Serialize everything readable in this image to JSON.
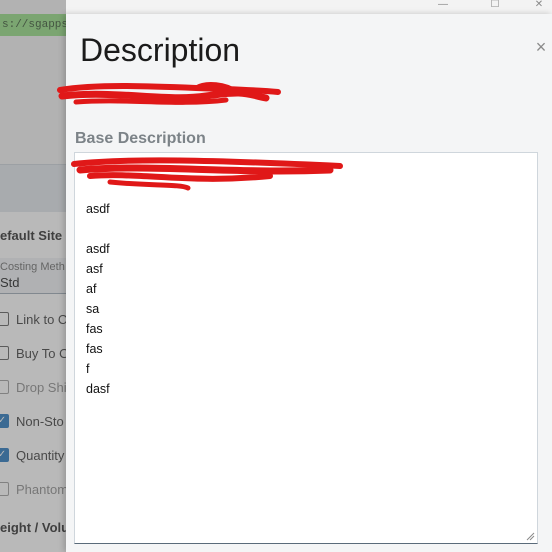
{
  "browser": {
    "url_fragment": "s://sgappsrv"
  },
  "background": {
    "section_title": "efault Site F",
    "costing_field": {
      "label": "Costing Meth",
      "value": "Std"
    },
    "checkboxes": [
      {
        "label": "Link to C",
        "checked": false,
        "dim": false
      },
      {
        "label": "Buy To O",
        "checked": false,
        "dim": false
      },
      {
        "label": "Drop Shi",
        "checked": false,
        "dim": true
      },
      {
        "label": "Non-Sto",
        "checked": true,
        "dim": false
      },
      {
        "label": "Quantity",
        "checked": true,
        "dim": false
      },
      {
        "label": "Phantom",
        "checked": false,
        "dim": true
      }
    ],
    "section_title_2": "eight / Volu"
  },
  "modal": {
    "title": "Description",
    "close_symbol": "×",
    "field_label": "Base Description",
    "text_lines": [
      "asdf",
      "",
      "asdf",
      "asf",
      "af",
      "sa",
      "fas",
      "fas",
      "f",
      "dasf"
    ]
  },
  "colors": {
    "accent": "#1a6fbb",
    "redaction": "#e01818",
    "url_bar": "#8fda7d"
  }
}
